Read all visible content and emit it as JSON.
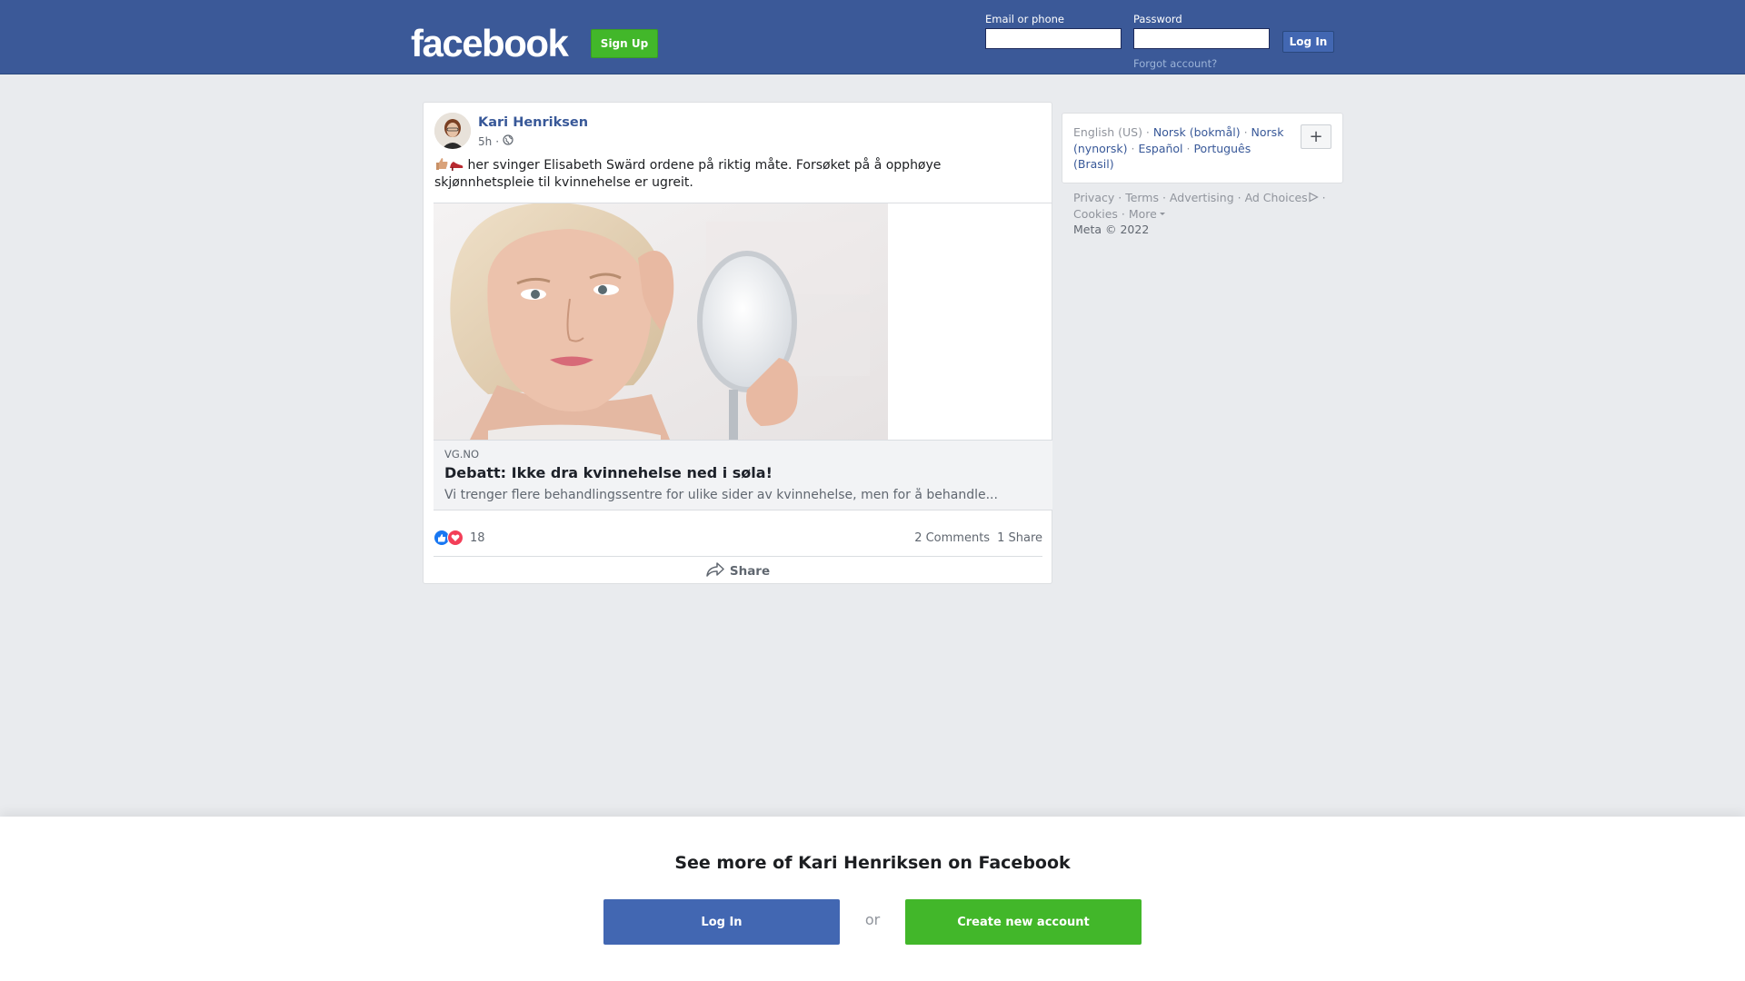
{
  "header": {
    "logo": "facebook",
    "signup_label": "Sign Up",
    "email_label": "Email or phone",
    "password_label": "Password",
    "email_value": "",
    "password_value": "",
    "login_label": "Log In",
    "forgot_label": "Forgot account?"
  },
  "post": {
    "author": "Kari Henriksen",
    "time": "5h",
    "separator": "·",
    "text": "her svinger Elisabeth Swärd ordene på riktig måte. Forsøket på å opphøye skjønnhetspleie til kvinnehelse er ugreit.",
    "link": {
      "domain": "VG.NO",
      "title": "Debatt: Ikke dra kvinnehelse ned i søla!",
      "description": "Vi trenger flere behandlingssentre for ulike sider av kvinnehelse, men for å behandle..."
    },
    "reactions": {
      "count": "18",
      "icons": [
        "like-icon",
        "love-icon"
      ]
    },
    "comments_label": "2 Comments",
    "shares_label": "1 Share",
    "share_button_label": "Share"
  },
  "languages": {
    "current": "English (US)",
    "options": [
      "Norsk (bokmål)",
      "Norsk (nynorsk)",
      "Español",
      "Português (Brasil)"
    ],
    "more_label": "+"
  },
  "footer": {
    "links": [
      "Privacy",
      "Terms",
      "Advertising",
      "Ad Choices",
      "Cookies",
      "More"
    ],
    "copyright": "Meta © 2022"
  },
  "banner": {
    "title": "See more of Kari Henriksen on Facebook",
    "login_label": "Log In",
    "or_label": "or",
    "create_label": "Create new account"
  },
  "colors": {
    "brand_blue": "#3b5998",
    "button_blue": "#4267b2",
    "signup_green": "#42b72a",
    "link_blue": "#385898"
  }
}
